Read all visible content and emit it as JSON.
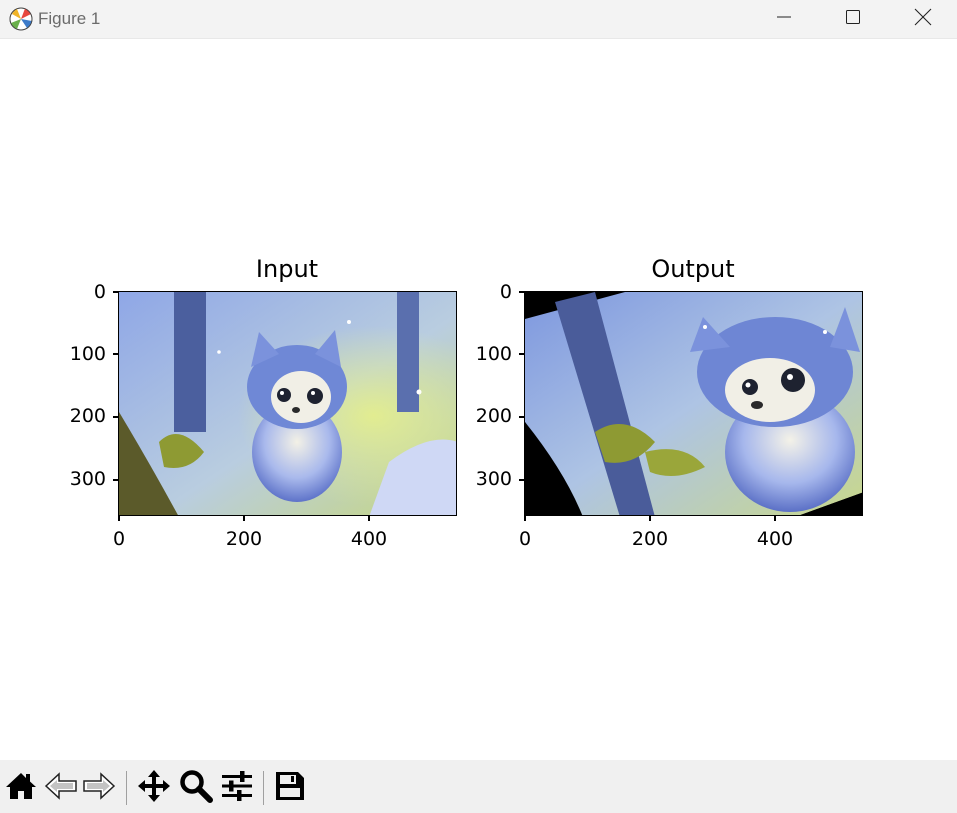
{
  "window": {
    "title": "Figure 1",
    "icons": {
      "app": "matplotlib-logo-icon",
      "minimize": "minimize-icon",
      "maximize": "maximize-icon",
      "close": "close-icon"
    }
  },
  "figure": {
    "left_panel": {
      "title": "Input",
      "y_ticks": [
        "0",
        "100",
        "200",
        "300"
      ],
      "x_ticks": [
        "0",
        "200",
        "400"
      ],
      "image": "photo of cartoon fluffy blue puppy in a snowy forest"
    },
    "right_panel": {
      "title": "Output",
      "y_ticks": [
        "0",
        "100",
        "200",
        "300"
      ],
      "x_ticks": [
        "0",
        "200",
        "400"
      ],
      "image": "rotated and zoomed version of the puppy image with black corners"
    }
  },
  "toolbar": {
    "tools": [
      {
        "name": "home",
        "icon": "home-icon"
      },
      {
        "name": "back",
        "icon": "back-arrow-icon"
      },
      {
        "name": "forward",
        "icon": "forward-arrow-icon"
      },
      {
        "name": "pan",
        "icon": "move-icon"
      },
      {
        "name": "zoom",
        "icon": "zoom-icon"
      },
      {
        "name": "configure-subplots",
        "icon": "sliders-icon"
      },
      {
        "name": "save",
        "icon": "save-icon"
      }
    ]
  },
  "colors": {
    "titlebar_bg": "#f3f3f3",
    "toolbar_bg": "#f0f0f0",
    "axes_frame": "#000000"
  }
}
